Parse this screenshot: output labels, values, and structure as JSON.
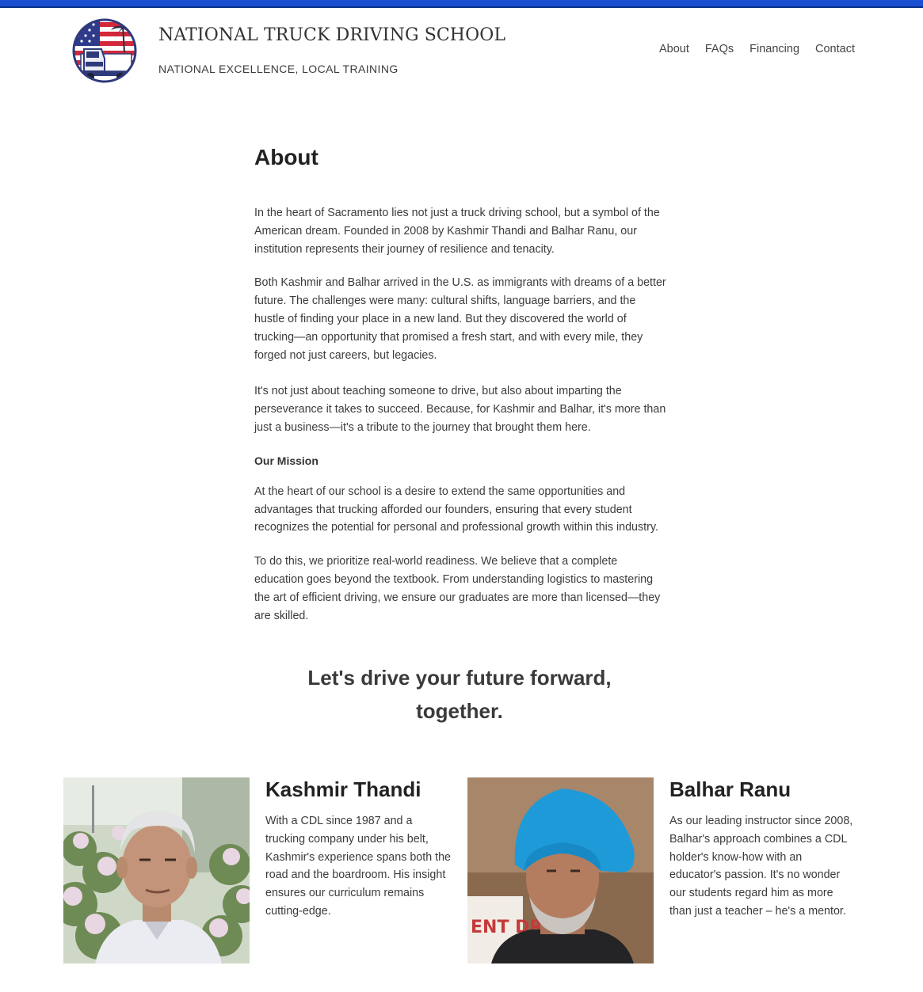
{
  "header": {
    "site_title": "NATIONAL TRUCK DRIVING SCHOOL",
    "site_tagline": "NATIONAL EXCELLENCE, LOCAL TRAINING",
    "logo_icon": "truck-flag-logo-icon",
    "nav": [
      {
        "label": "About"
      },
      {
        "label": "FAQs"
      },
      {
        "label": "Financing"
      },
      {
        "label": "Contact"
      }
    ]
  },
  "main": {
    "title": "About",
    "paragraphs": [
      "In the heart of Sacramento lies not just a truck driving school, but a symbol of the American dream. Founded in 2008 by Kashmir Thandi and Balhar Ranu, our institution represents their journey of resilience and tenacity.",
      "Both Kashmir and Balhar arrived in the U.S. as immigrants with dreams of a better future. The challenges were many: cultural shifts, language barriers, and the hustle of finding your place in a new land. But they discovered the world of trucking—an opportunity that promised a fresh start, and with every mile, they forged not just careers, but legacies.",
      "It's not just about teaching someone to drive, but also about imparting the perseverance it takes to succeed. Because, for Kashmir and Balhar, it's more than just a business—it's a tribute to the journey that brought them here."
    ],
    "mission_heading": "Our Mission",
    "mission_paragraphs": [
      "At the heart of our school is a desire to extend the same opportunities and advantages that trucking afforded our founders, ensuring that every student recognizes the potential for personal and professional growth within this industry.",
      "To do this, we prioritize real-world readiness. We believe that a complete education goes beyond the textbook. From understanding logistics to mastering the art of efficient driving, we ensure our graduates are more than licensed—they are skilled."
    ],
    "slogan": "Let's drive your future forward, together."
  },
  "people": [
    {
      "name": "Kashmir Thandi",
      "bio": "With a CDL since 1987 and a trucking company under his belt, Kashmir's experience spans both the road and the boardroom. His insight ensures our curriculum remains cutting-edge."
    },
    {
      "name": "Balhar Ranu",
      "bio": "As our leading instructor since 2008, Balhar's approach combines a CDL holder's know-how with an educator's passion. It's no wonder our students regard him as more than just a teacher – he's a mentor."
    }
  ],
  "colors": {
    "accent_bar": "#1a4fd1",
    "turban": "#1e9ad8"
  }
}
